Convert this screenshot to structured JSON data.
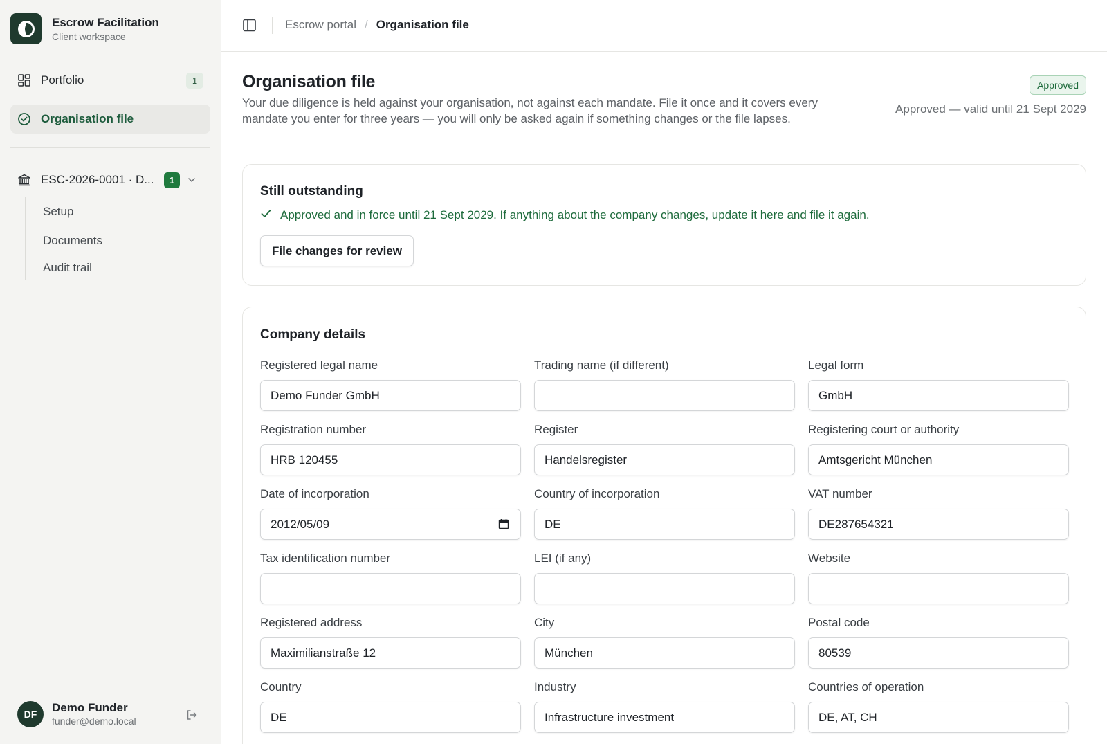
{
  "brand": {
    "name": "Escrow Facilitation",
    "subtitle": "Client workspace"
  },
  "sidebar": {
    "items": [
      {
        "label": "Portfolio",
        "count": "1",
        "icon": "grid-icon"
      },
      {
        "label": "Organisation file",
        "icon": "check-circle-icon",
        "active": true
      }
    ],
    "mandate": {
      "label": "ESC-2026-0001 · D...",
      "badge": "1",
      "icon": "bank-icon",
      "subitems": [
        "Setup",
        "Documents",
        "Audit trail"
      ]
    }
  },
  "user": {
    "initials": "DF",
    "name": "Demo Funder",
    "email": "funder@demo.local"
  },
  "breadcrumb": {
    "parent": "Escrow portal",
    "separator": "/",
    "current": "Organisation file"
  },
  "page": {
    "title": "Organisation file",
    "description": "Your due diligence is held against your organisation, not against each mandate. File it once and it covers every mandate you enter for three years — you will only be asked again if something changes or the file lapses.",
    "status": "Approved",
    "status_note": "Approved — valid until 21 Sept 2029"
  },
  "outstanding": {
    "title": "Still outstanding",
    "message": "Approved and in force until 21 Sept 2029. If anything about the company changes, update it here and file it again.",
    "button": "File changes for review"
  },
  "company": {
    "title": "Company details",
    "fields": [
      {
        "label": "Registered legal name",
        "value": "Demo Funder GmbH"
      },
      {
        "label": "Trading name (if different)",
        "value": ""
      },
      {
        "label": "Legal form",
        "value": "GmbH"
      },
      {
        "label": "Registration number",
        "value": "HRB 120455"
      },
      {
        "label": "Register",
        "value": "Handelsregister"
      },
      {
        "label": "Registering court or authority",
        "value": "Amtsgericht München"
      },
      {
        "label": "Date of incorporation",
        "value": "2012/05/09"
      },
      {
        "label": "Country of incorporation",
        "value": "DE"
      },
      {
        "label": "VAT number",
        "value": "DE287654321"
      },
      {
        "label": "Tax identification number",
        "value": ""
      },
      {
        "label": "LEI (if any)",
        "value": ""
      },
      {
        "label": "Website",
        "value": ""
      },
      {
        "label": "Registered address",
        "value": "Maximilianstraße 12"
      },
      {
        "label": "City",
        "value": "München"
      },
      {
        "label": "Postal code",
        "value": "80539"
      },
      {
        "label": "Country",
        "value": "DE"
      },
      {
        "label": "Industry",
        "value": "Infrastructure investment"
      },
      {
        "label": "Countries of operation",
        "value": "DE, AT, CH"
      }
    ]
  },
  "colors": {
    "brand_dark": "#1f3a2e",
    "accent_green": "#1e6b3c",
    "badge_green": "#1f7a3e",
    "sidebar_bg": "#f4f4f2"
  }
}
